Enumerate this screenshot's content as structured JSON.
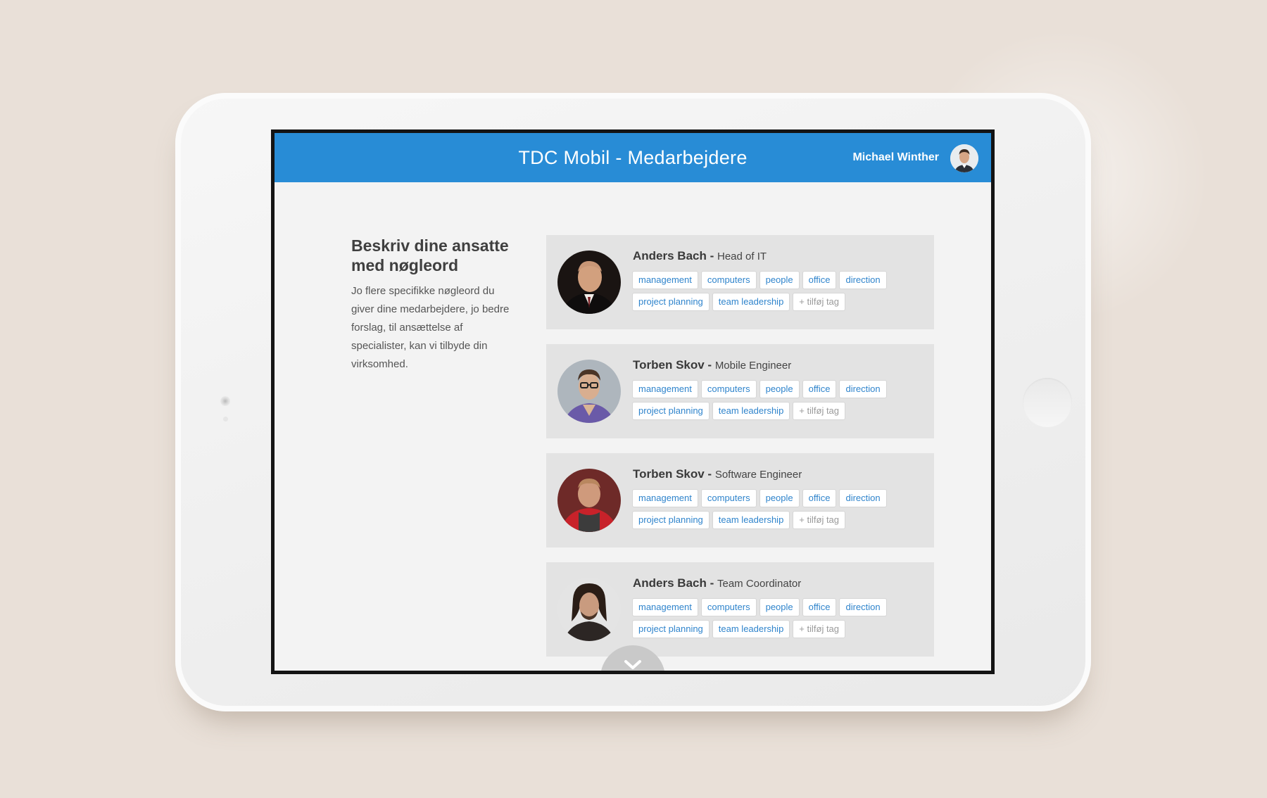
{
  "header": {
    "title": "TDC Mobil - Medarbejdere"
  },
  "user": {
    "name": "Michael Winther"
  },
  "intro": {
    "title": "Beskriv dine ansatte med nøgleord",
    "text": "Jo flere specifikke nøgleord du giver dine medarbejdere, jo bedre forslag, til ansættelse af specialister, kan vi tilbyde din virksomhed."
  },
  "employees": [
    {
      "name": "Anders Bach",
      "separator": " - ",
      "role": "Head of IT",
      "tags_row1": [
        "management",
        "computers",
        "people",
        "office",
        "direction"
      ],
      "tags_row2": [
        "project planning",
        "team leadership"
      ],
      "add_tag": "+  tilføj tag"
    },
    {
      "name": "Torben Skov",
      "separator": " - ",
      "role": "Mobile Engineer",
      "tags_row1": [
        "management",
        "computers",
        "people",
        "office",
        "direction"
      ],
      "tags_row2": [
        "project planning",
        "team leadership"
      ],
      "add_tag": "+  tilføj tag"
    },
    {
      "name": "Torben Skov",
      "separator": " - ",
      "role": "Software Engineer",
      "tags_row1": [
        "management",
        "computers",
        "people",
        "office",
        "direction"
      ],
      "tags_row2": [
        "project planning",
        "team leadership"
      ],
      "add_tag": "+  tilføj tag"
    },
    {
      "name": "Anders Bach",
      "separator": " - ",
      "role": "Team Coordinator",
      "tags_row1": [
        "management",
        "computers",
        "people",
        "office",
        "direction"
      ],
      "tags_row2": [
        "project planning",
        "team leadership"
      ],
      "add_tag": "+  tilføj tag"
    }
  ],
  "icons": {
    "scroll": "chevron-down-icon"
  },
  "colors": {
    "header": "#288cd6",
    "tag_text": "#2f84cc",
    "card_bg": "#e3e3e3"
  }
}
